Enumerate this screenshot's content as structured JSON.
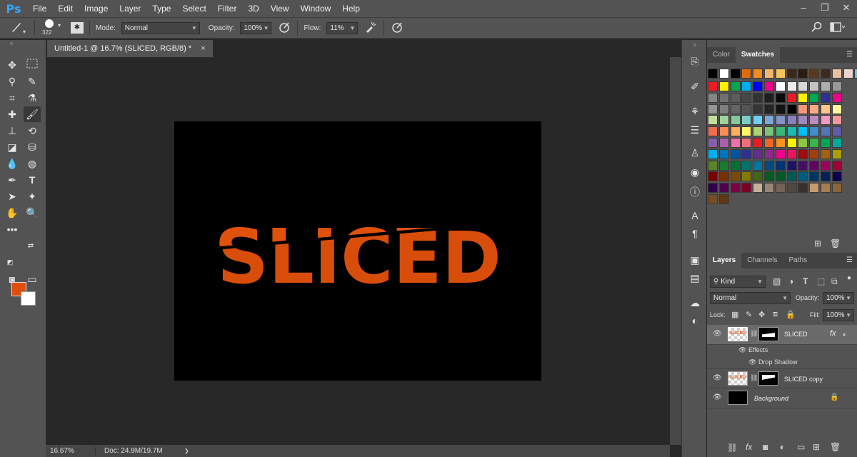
{
  "app": {
    "logo": "Ps"
  },
  "menu": [
    "File",
    "Edit",
    "Image",
    "Layer",
    "Type",
    "Select",
    "Filter",
    "3D",
    "View",
    "Window",
    "Help"
  ],
  "window_controls": {
    "minimize": "–",
    "restore": "❐",
    "close": "✕"
  },
  "options": {
    "brush_size": "322",
    "mode_label": "Mode:",
    "mode_value": "Normal",
    "opacity_label": "Opacity:",
    "opacity_value": "100%",
    "flow_label": "Flow:",
    "flow_value": "11%"
  },
  "document": {
    "tab_title": "Untitled-1 @ 16.7% (SLICED, RGB/8) *",
    "close_glyph": "×",
    "text": "SLICED",
    "text_color": "#e0510c"
  },
  "status": {
    "zoom": "16.67%",
    "doc_size": "Doc: 24.9M/19.7M",
    "arrow": "❯"
  },
  "colors": {
    "foreground": "#e04e0c",
    "background": "#ffffff"
  },
  "swatch_panel": {
    "tabs": [
      "Color",
      "Swatches"
    ],
    "active": "Swatches"
  },
  "swatch_rows": [
    [
      "#000000",
      "#ffffff",
      "#000000",
      "#e06b0c",
      "#f08c1c",
      "#f6b56f",
      "#f8c45e",
      "#3a2a16",
      "#2b1b10",
      "#5a3a1e",
      "#3d2c1e",
      "#e8c1a0",
      "#e9d5cc",
      "#6cc4cf"
    ],
    [
      "#ed1c24",
      "#fff200",
      "#00a651",
      "#00aeef",
      "#0000ff",
      "#ec008c",
      "#ffffff",
      "#ebebeb",
      "#d7d7d7",
      "#c2c2c2",
      "#aeaeae",
      "#999999"
    ],
    [
      "#858585",
      "#707070",
      "#5c5c5c",
      "#474747",
      "#333333",
      "#1e1e1e",
      "#0a0a0a",
      "#ed1c24",
      "#fff200",
      "#00a651",
      "#2e3192",
      "#ec008c"
    ],
    [
      "#959595",
      "#7d7d7d",
      "#656565",
      "#555555",
      "#363636",
      "#242424",
      "#111111",
      "#000000",
      "#f7977a",
      "#f9ad81",
      "#fdc68a",
      "#fff79a"
    ],
    [
      "#c4df9b",
      "#a3d39c",
      "#82ca9d",
      "#7accc8",
      "#6dcff6",
      "#7da7d9",
      "#8393ca",
      "#8781bd",
      "#a187be",
      "#bd8cbf",
      "#f49ac1",
      "#f5989d"
    ],
    [
      "#f26c4f",
      "#f68e56",
      "#fbaf5d",
      "#fff568",
      "#acd372",
      "#7cc576",
      "#3bb878",
      "#1abbb4",
      "#00bff3",
      "#438ccb",
      "#5574b9",
      "#605ca8"
    ],
    [
      "#855fa8",
      "#a863a8",
      "#f06ea9",
      "#f26d7d",
      "#ed1c24",
      "#f26522",
      "#f7941d",
      "#fff200",
      "#8dc63f",
      "#39b54a",
      "#00a651",
      "#00a99d"
    ],
    [
      "#00aeef",
      "#0072bc",
      "#0054a6",
      "#2e3192",
      "#662d91",
      "#92278f",
      "#ec008c",
      "#ed145b",
      "#9e0b0f",
      "#a0410d",
      "#a36209",
      "#aba000"
    ],
    [
      "#598527",
      "#197b30",
      "#007236",
      "#00746b",
      "#0076a3",
      "#004b80",
      "#003471",
      "#1b1464",
      "#440e62",
      "#630460",
      "#9e005d",
      "#9e0039"
    ],
    [
      "#790000",
      "#7b2e00",
      "#7d4900",
      "#827b00",
      "#406618",
      "#005e20",
      "#005826",
      "#005952",
      "#005b7f",
      "#003663",
      "#002157",
      "#0d004c"
    ],
    [
      "#32004b",
      "#4b0049",
      "#7b0046",
      "#7a0026",
      "#c7b299",
      "#998675",
      "#736357",
      "#534741",
      "#37302d",
      "#c69c6d",
      "#a67c52",
      "#8c6239"
    ],
    [
      "#754c24",
      "#603913"
    ]
  ],
  "layers_panel": {
    "tabs": [
      "Layers",
      "Channels",
      "Paths"
    ],
    "active": "Layers",
    "filter_kind": "Kind",
    "blend_mode": "Normal",
    "opacity_label": "Opacity:",
    "opacity_value": "100%",
    "lock_label": "Lock:",
    "fill_label": "Fill:",
    "fill_value": "100%",
    "layers": {
      "sliced": "SLICED",
      "effects": "Effects",
      "drop_shadow": "Drop Shadow",
      "sliced_copy": "SLICED copy",
      "background": "Background"
    },
    "fx_glyph": "fx"
  }
}
